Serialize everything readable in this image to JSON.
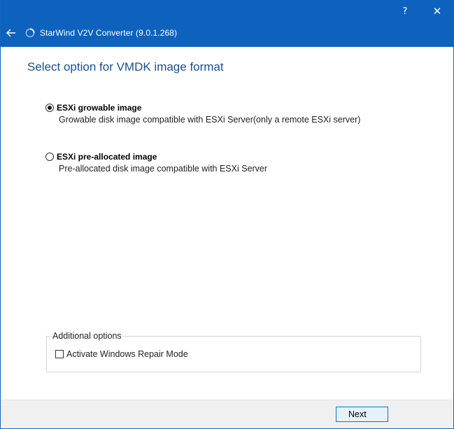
{
  "window": {
    "title": "StarWind V2V Converter (9.0.1.268)",
    "help_glyph": "?",
    "close_glyph": "✕",
    "back_icon": "arrow-left-icon",
    "logo_icon": "starwind-ring-icon"
  },
  "page": {
    "title": "Select option for VMDK image format"
  },
  "options": [
    {
      "label": "ESXi growable image",
      "description": "Growable disk image compatible with ESXi Server(only a remote ESXi server)",
      "selected": true
    },
    {
      "label": "ESXi pre-allocated image",
      "description": "Pre-allocated disk image compatible with ESXi Server",
      "selected": false
    }
  ],
  "additional": {
    "legend": "Additional options",
    "repair_mode_label": "Activate Windows Repair Mode",
    "repair_mode_checked": false
  },
  "footer": {
    "next_label": "Next"
  },
  "colors": {
    "titlebar": "#0d62bd",
    "heading": "#1a4f8f",
    "button_border": "#0078d7"
  }
}
